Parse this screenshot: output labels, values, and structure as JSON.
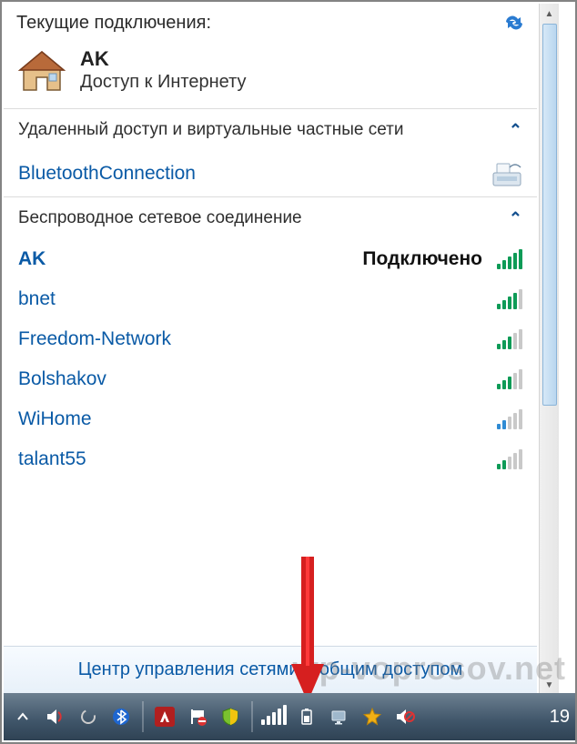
{
  "header": {
    "title": "Текущие подключения:"
  },
  "current": {
    "name": "AK",
    "status": "Доступ к Интернету"
  },
  "groups": {
    "dialup": {
      "label": "Удаленный доступ и виртуальные частные сети",
      "items": [
        {
          "name": "BluetoothConnection"
        }
      ]
    },
    "wireless": {
      "label": "Беспроводное сетевое соединение",
      "networks": [
        {
          "name": "AK",
          "status": "Подключено",
          "strength": 5,
          "connected": true
        },
        {
          "name": "bnet",
          "strength": 4
        },
        {
          "name": "Freedom-Network",
          "strength": 3
        },
        {
          "name": "Bolshakov",
          "strength": 3
        },
        {
          "name": "WiHome",
          "strength": 2
        },
        {
          "name": "talant55",
          "strength": 2
        }
      ]
    }
  },
  "footer": {
    "link": "Центр управления сетями и общим доступом"
  },
  "watermark": "wp-voprosov.net",
  "taskbar": {
    "clock": "19",
    "icons": [
      "chevron-up-icon",
      "volume-icon",
      "spinner-icon",
      "bluetooth-icon",
      "adobe-icon",
      "flag-blocked-icon",
      "shield-icon",
      "network-bars-icon",
      "battery-icon",
      "pc-icon",
      "star-icon",
      "volume-muted-icon"
    ]
  }
}
